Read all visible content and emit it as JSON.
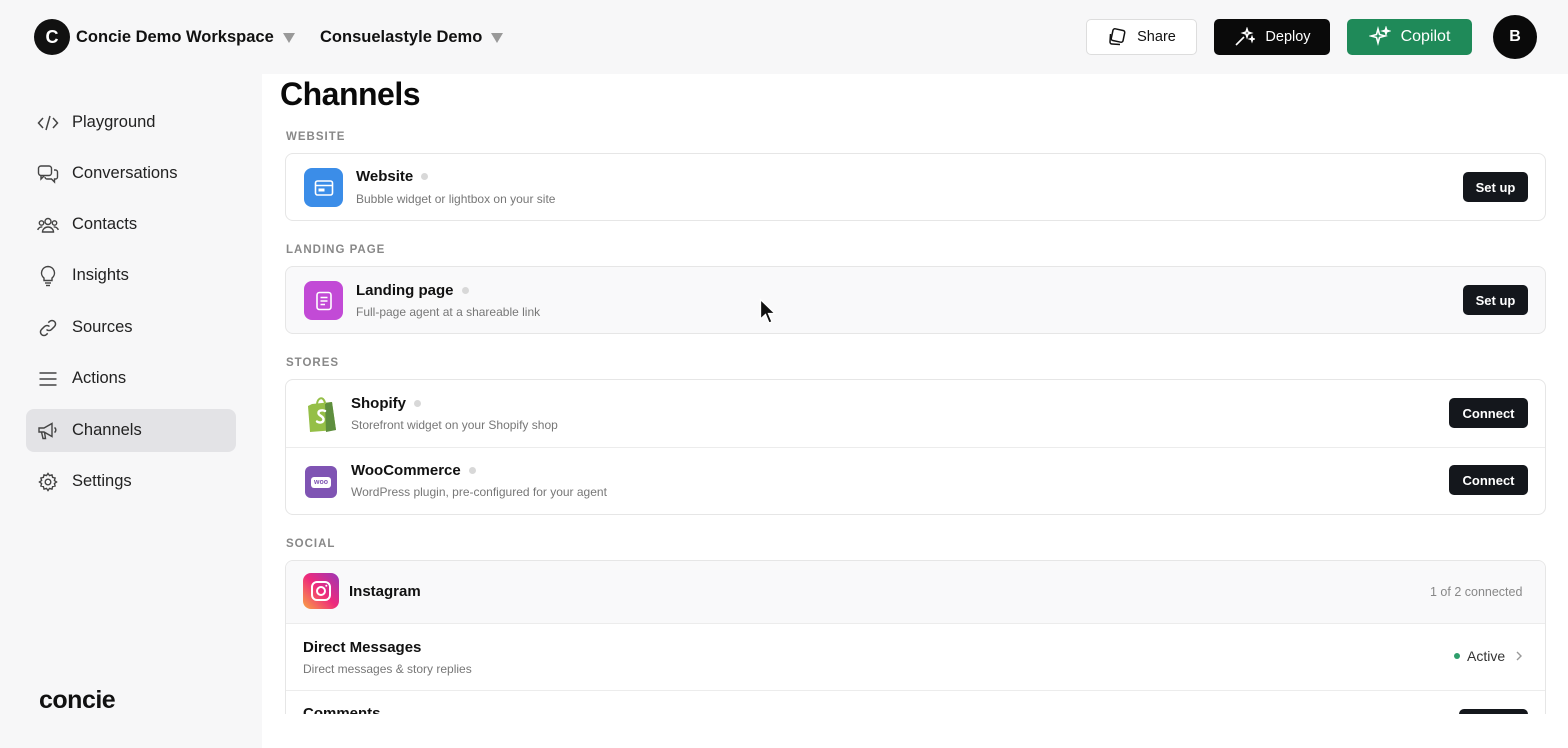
{
  "workspace": {
    "avatar_letter": "C",
    "name": "Concie Demo Workspace"
  },
  "project": {
    "name": "Consuelastyle Demo"
  },
  "header": {
    "share_label": "Share",
    "deploy_label": "Deploy",
    "copilot_label": "Copilot",
    "user_avatar_letter": "B"
  },
  "sidebar": {
    "items": [
      {
        "label": "Playground",
        "icon": "code-icon"
      },
      {
        "label": "Conversations",
        "icon": "chat-bubbles-icon"
      },
      {
        "label": "Contacts",
        "icon": "users-icon"
      },
      {
        "label": "Insights",
        "icon": "lightbulb-icon"
      },
      {
        "label": "Sources",
        "icon": "link-icon"
      },
      {
        "label": "Actions",
        "icon": "list-icon"
      },
      {
        "label": "Channels",
        "icon": "megaphone-icon",
        "active": true
      },
      {
        "label": "Settings",
        "icon": "gear-icon"
      }
    ],
    "logo_text": "concie"
  },
  "main": {
    "title": "Channels",
    "sections": {
      "website": "WEBSITE",
      "landing": "LANDING PAGE",
      "stores": "STORES",
      "social": "SOCIAL"
    },
    "website": {
      "title": "Website",
      "description": "Bubble widget or lightbox on your site",
      "action": "Set up"
    },
    "landing": {
      "title": "Landing page",
      "description": "Full-page agent at a shareable link",
      "action": "Set up"
    },
    "shopify": {
      "title": "Shopify",
      "description": "Storefront widget on your Shopify shop",
      "action": "Connect"
    },
    "woocommerce": {
      "title": "WooCommerce",
      "description": "WordPress plugin, pre-configured for your agent",
      "action": "Connect",
      "icon_text": "woo"
    },
    "instagram": {
      "title": "Instagram",
      "connected": "1 of 2 connected",
      "dm_title": "Direct Messages",
      "dm_description": "Direct messages & story replies",
      "dm_status": "Active",
      "comments_title": "Comments"
    }
  },
  "colors": {
    "copilot": "#1f8a59",
    "dark_button": "#14171c",
    "website_icon": "#3b8de8",
    "landing_icon": "#c24ad6",
    "woo_icon": "#7f54b3",
    "status_active": "#2e9e6b"
  }
}
